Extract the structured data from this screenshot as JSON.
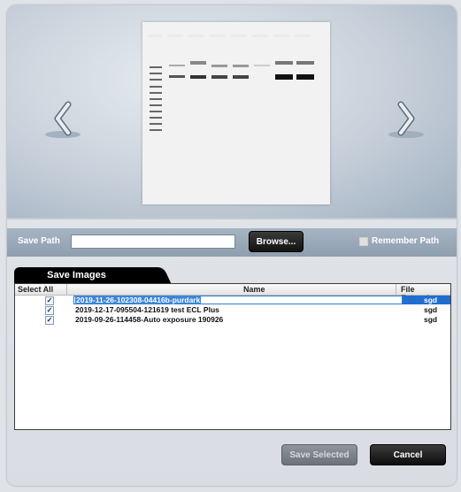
{
  "preview": {
    "prev_icon": "chevron-left-icon",
    "next_icon": "chevron-right-icon"
  },
  "save_path": {
    "label": "Save Path",
    "value": "",
    "browse_label": "Browse...",
    "remember_label": "Remember Path",
    "remember_checked": false
  },
  "tab": {
    "label": "Save Images"
  },
  "table": {
    "headers": {
      "select_all": "Select All",
      "name": "Name",
      "extension": "File Extension"
    },
    "rows": [
      {
        "checked": true,
        "name": "2019-11-26-102308-04416b-purdark",
        "extension": "sgd",
        "selected": true
      },
      {
        "checked": true,
        "name": "2019-12-17-095504-121619 test ECL Plus",
        "extension": "sgd",
        "selected": false
      },
      {
        "checked": true,
        "name": "2019-09-26-114458-Auto exposure 190926",
        "extension": "sgd",
        "selected": false
      }
    ]
  },
  "buttons": {
    "save_selected": "Save Selected",
    "cancel": "Cancel"
  }
}
